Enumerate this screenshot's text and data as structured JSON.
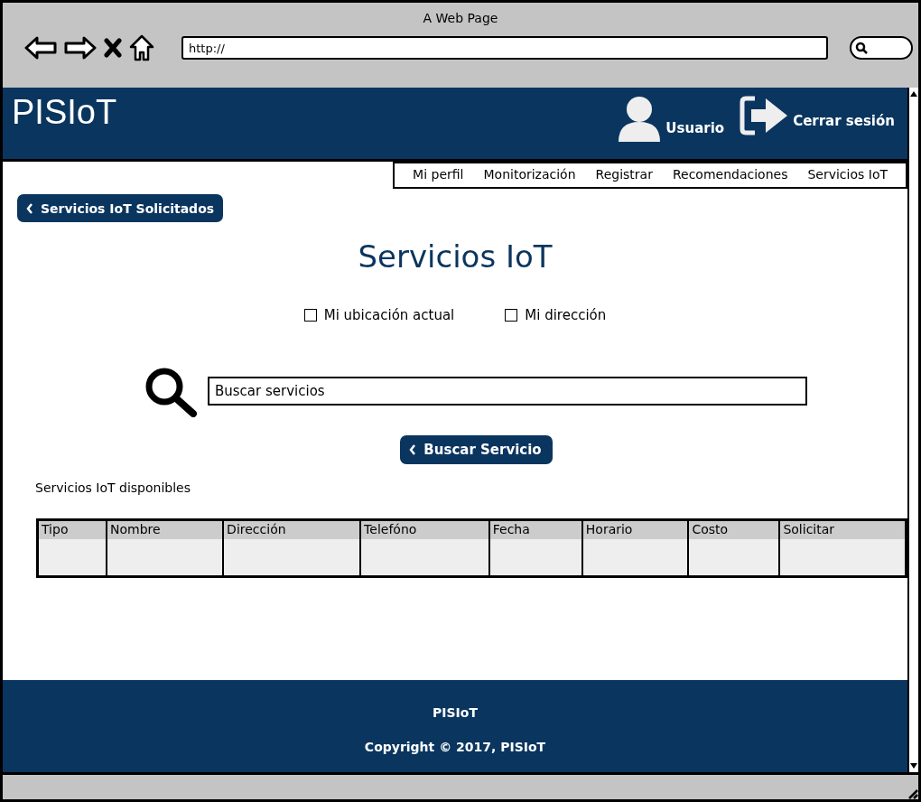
{
  "window": {
    "title": "A Web Page",
    "url": "http://"
  },
  "header": {
    "logo": "PISIoT",
    "user": "Usuario",
    "logout": "Cerrar sesión"
  },
  "nav": [
    {
      "label": "Mi perfil"
    },
    {
      "label": "Monitorización"
    },
    {
      "label": "Registrar"
    },
    {
      "label": "Recomendaciones"
    },
    {
      "label": "Servicios IoT"
    }
  ],
  "back_button": "Servicios IoT Solicitados",
  "title": "Servicios IoT",
  "options": [
    {
      "label": "Mi ubicación actual",
      "checked": false
    },
    {
      "label": "Mi dirección",
      "checked": false
    }
  ],
  "search": {
    "placeholder": "Buscar servicios"
  },
  "search_button": "Buscar Servicio",
  "table": {
    "caption": "Servicios IoT disponibles",
    "columns": [
      "Tipo",
      "Nombre",
      "Dirección",
      "Telefóno",
      "Fecha",
      "Horario",
      "Costo",
      "Solicitar"
    ]
  },
  "footer": {
    "name": "PISIoT",
    "copyright": "Copyright © 2017, PISIoT"
  }
}
